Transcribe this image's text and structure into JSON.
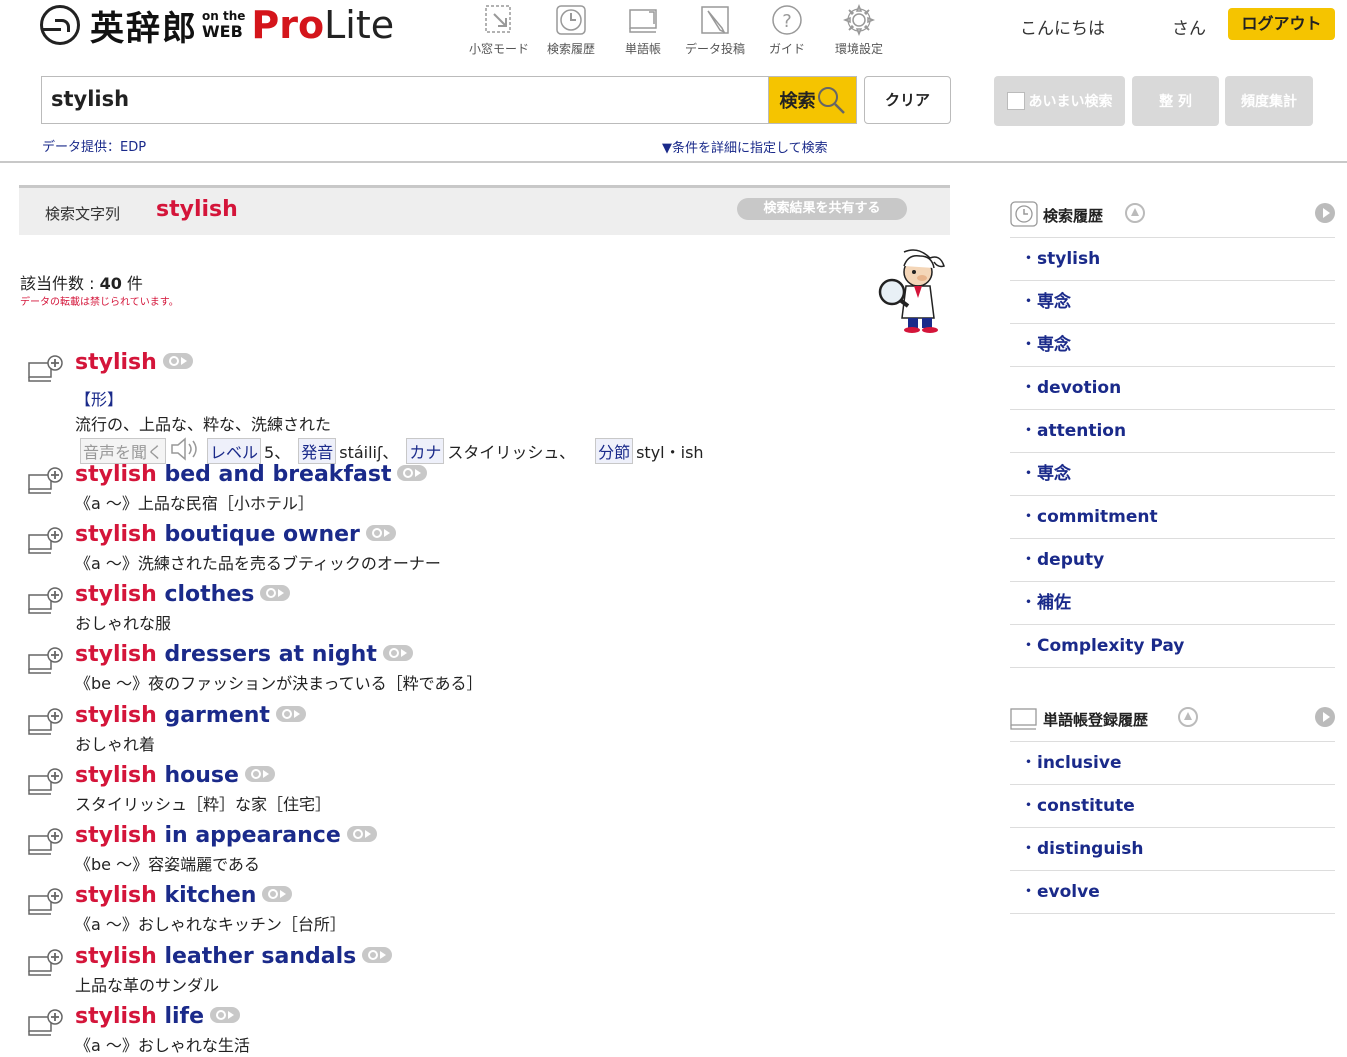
{
  "header": {
    "logo_brand": "英辞郎",
    "logo_on_the": "on the",
    "logo_web": "WEB",
    "logo_pro": "Pro",
    "logo_lite": "Lite",
    "tools": [
      {
        "label": "小窓モード",
        "icon": "popup-window-icon"
      },
      {
        "label": "検索履歴",
        "icon": "clock-icon"
      },
      {
        "label": "単語帳",
        "icon": "wordbook-icon"
      },
      {
        "label": "データ投稿",
        "icon": "pen-icon"
      },
      {
        "label": "ガイド",
        "icon": "question-icon"
      },
      {
        "label": "環境設定",
        "icon": "gear-icon"
      }
    ],
    "greeting": "こんにちは",
    "san": "さん",
    "logout": "ログアウト"
  },
  "search": {
    "value": "stylish",
    "button": "検索",
    "clear": "クリア",
    "fuzzy": "あいまい検索",
    "sort": "整 列",
    "frequency": "頻度集計",
    "data_provider": "データ提供：EDP",
    "detail_link": "▼条件を詳細に指定して検索"
  },
  "query_bar": {
    "label": "検索文字列",
    "query": "stylish",
    "share": "検索結果を共有する"
  },
  "results_meta": {
    "count_label": "該当件数 : ",
    "count": "40",
    "count_unit": " 件",
    "copyright": "データの転載は禁じられています。"
  },
  "results": [
    {
      "kw": "stylish",
      "rest": "",
      "pos": "【形】",
      "def": "流行の、上品な、粋な、洗練された",
      "attrs": {
        "listen": "音声を聞く",
        "level_label": "レベル",
        "level": "5、",
        "pron_label": "発音",
        "pron": "stáiliʃ、",
        "kana_label": "カナ",
        "kana": "スタイリッシュ、",
        "syll_label": "分節",
        "syll": "styl・ish"
      }
    },
    {
      "kw": "stylish",
      "rest": " bed and breakfast",
      "def": "《a ～》上品な民宿［小ホテル］"
    },
    {
      "kw": "stylish",
      "rest": " boutique owner",
      "def": "《a ～》洗練された品を売るブティックのオーナー"
    },
    {
      "kw": "stylish",
      "rest": " clothes",
      "def": "おしゃれな服"
    },
    {
      "kw": "stylish",
      "rest": " dressers at night",
      "def": "《be ～》夜のファッションが決まっている［粋である］"
    },
    {
      "kw": "stylish",
      "rest": " garment",
      "def": "おしゃれ着"
    },
    {
      "kw": "stylish",
      "rest": " house",
      "def": "スタイリッシュ［粋］な家［住宅］"
    },
    {
      "kw": "stylish",
      "rest": " in appearance",
      "def": "《be ～》容姿端麗である"
    },
    {
      "kw": "stylish",
      "rest": " kitchen",
      "def": "《a ～》おしゃれなキッチン［台所］"
    },
    {
      "kw": "stylish",
      "rest": " leather sandals",
      "def": "上品な革のサンダル"
    },
    {
      "kw": "stylish",
      "rest": " life",
      "def": "《a ～》おしゃれな生活"
    }
  ],
  "sidebar": {
    "history_title": "検索履歴",
    "history": [
      "stylish",
      "専念",
      "専念",
      "devotion",
      "attention",
      "専念",
      "commitment",
      "deputy",
      "補佐",
      "Complexity Pay"
    ],
    "wordbook_title": "単語帳登録履歴",
    "wordbook": [
      "inclusive",
      "constitute",
      "distinguish",
      "evolve"
    ]
  }
}
